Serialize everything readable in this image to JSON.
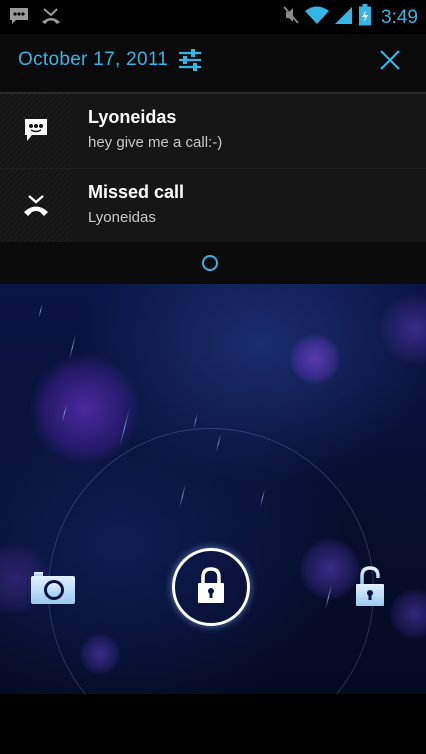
{
  "status_bar": {
    "time": "3:49",
    "icons": [
      "message-notification-icon",
      "missed-call-notification-icon",
      "mute-icon",
      "wifi-icon",
      "signal-icon",
      "battery-icon"
    ]
  },
  "notification_shade": {
    "date": "October 17, 2011",
    "settings_icon": "settings-sliders-icon",
    "close_icon": "close-icon",
    "accent_color": "#33b5e5",
    "notifications": [
      {
        "icon": "message-icon",
        "title": "Lyoneidas",
        "body": "hey give me a call:-)"
      },
      {
        "icon": "missed-call-icon",
        "title": "Missed call",
        "body": "Lyoneidas"
      }
    ]
  },
  "lockscreen": {
    "left_target_icon": "camera-icon",
    "center_icon": "lock-icon",
    "right_target_icon": "unlock-icon"
  }
}
